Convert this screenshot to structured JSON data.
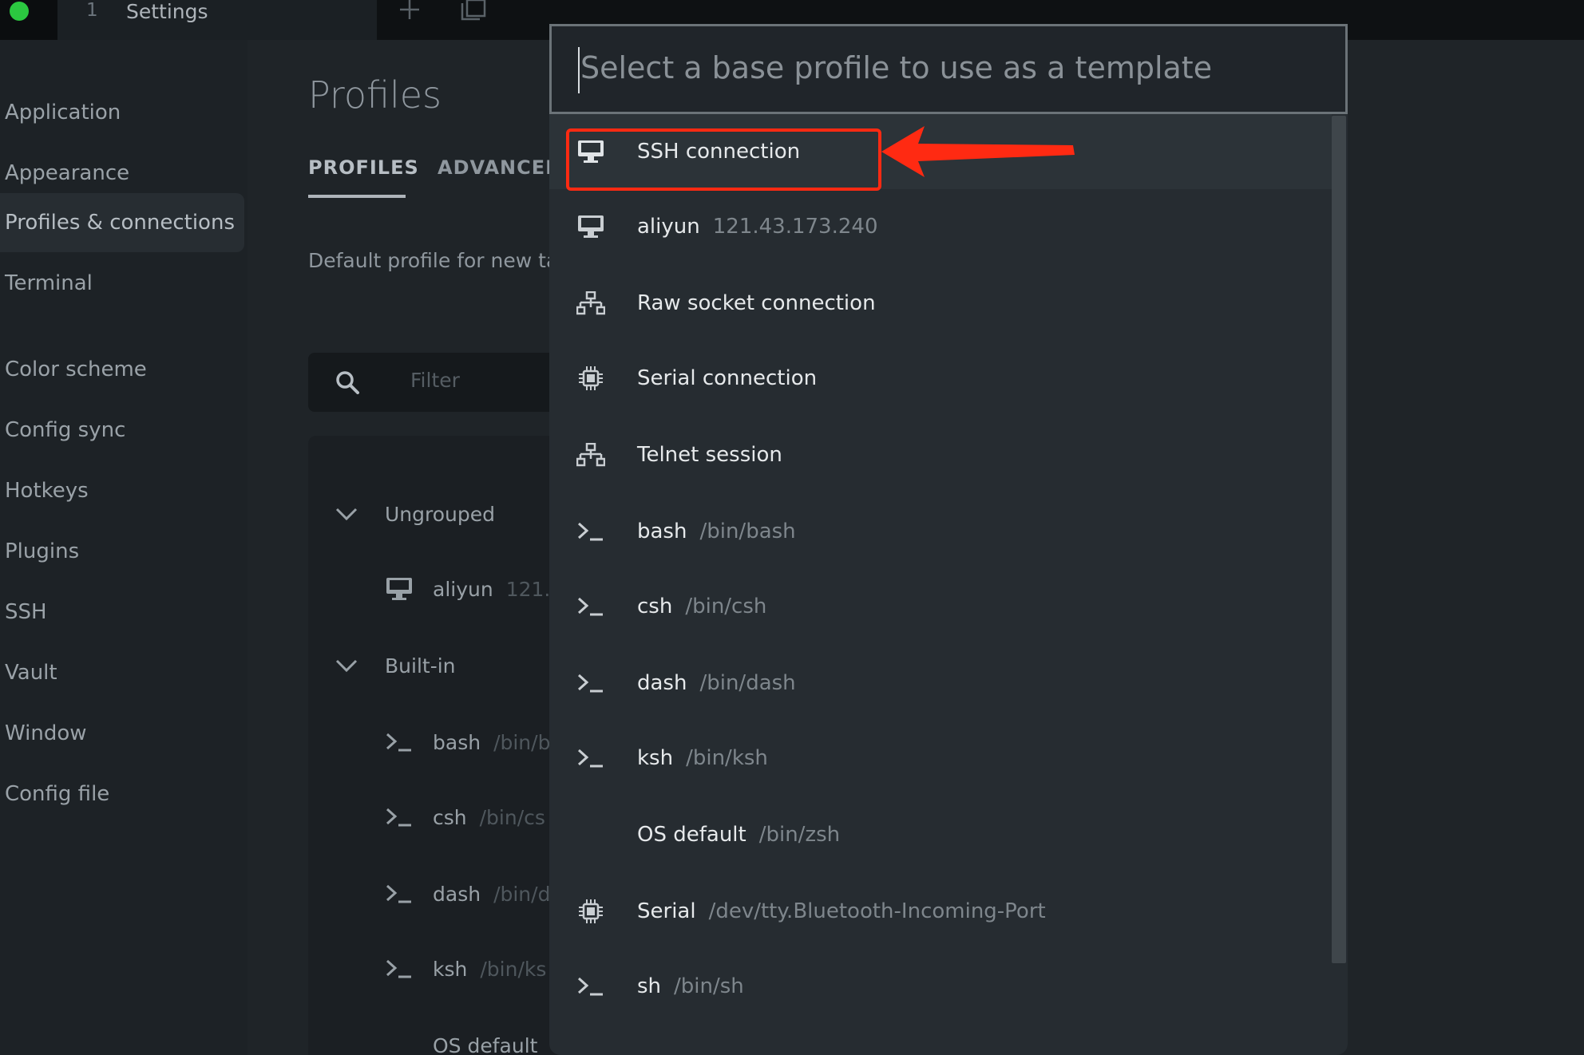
{
  "tabbar": {
    "tab_number": "1",
    "tab_title": "Settings"
  },
  "sidebar": {
    "items": [
      {
        "label": "Application"
      },
      {
        "label": "Appearance"
      },
      {
        "label": "Profiles & connections",
        "active": true
      },
      {
        "label": "Terminal"
      },
      {
        "label": "Color scheme"
      },
      {
        "label": "Config sync"
      },
      {
        "label": "Hotkeys"
      },
      {
        "label": "Plugins"
      },
      {
        "label": "SSH"
      },
      {
        "label": "Vault"
      },
      {
        "label": "Window"
      },
      {
        "label": "Config file"
      }
    ]
  },
  "main": {
    "title": "Profiles",
    "tabs": [
      {
        "label": "PROFILES",
        "active": true
      },
      {
        "label": "ADVANCED"
      }
    ],
    "default_profile_label": "Default profile for new tab",
    "filter_placeholder": "Filter",
    "groups": [
      {
        "label": "Ungrouped",
        "items": [
          {
            "label": "aliyun",
            "sub": "121."
          }
        ]
      },
      {
        "label": "Built-in",
        "items": [
          {
            "label": "bash",
            "sub": "/bin/b"
          },
          {
            "label": "csh",
            "sub": "/bin/cs"
          },
          {
            "label": "dash",
            "sub": "/bin/d"
          },
          {
            "label": "ksh",
            "sub": "/bin/ks"
          },
          {
            "label": "OS default",
            "sub": ""
          }
        ]
      }
    ]
  },
  "dialog": {
    "placeholder": "Select a base profile to use as a template",
    "options": [
      {
        "label": "SSH connection",
        "sub": "",
        "icon": "monitor-icon",
        "highlighted": true
      },
      {
        "label": "aliyun",
        "sub": "121.43.173.240",
        "icon": "monitor-icon"
      },
      {
        "label": "Raw socket connection",
        "sub": "",
        "icon": "network-icon"
      },
      {
        "label": "Serial connection",
        "sub": "",
        "icon": "chip-icon"
      },
      {
        "label": "Telnet session",
        "sub": "",
        "icon": "network-icon"
      },
      {
        "label": "bash",
        "sub": "/bin/bash",
        "icon": "terminal-icon"
      },
      {
        "label": "csh",
        "sub": "/bin/csh",
        "icon": "terminal-icon"
      },
      {
        "label": "dash",
        "sub": "/bin/dash",
        "icon": "terminal-icon"
      },
      {
        "label": "ksh",
        "sub": "/bin/ksh",
        "icon": "terminal-icon"
      },
      {
        "label": "OS default",
        "sub": "/bin/zsh",
        "icon": ""
      },
      {
        "label": "Serial",
        "sub": "/dev/tty.Bluetooth-Incoming-Port",
        "icon": "chip-icon"
      },
      {
        "label": "sh",
        "sub": "/bin/sh",
        "icon": "terminal-icon"
      }
    ]
  },
  "colors": {
    "annotation": "#ff2a12",
    "traffic_light": "#2bc840"
  }
}
